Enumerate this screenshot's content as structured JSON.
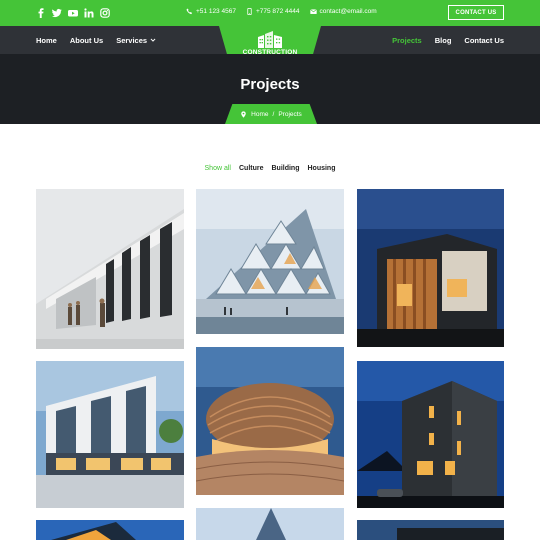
{
  "colors": {
    "accent": "#45c438",
    "nav_bg": "#2f3237",
    "hero_bg": "#1d2024"
  },
  "topbar": {
    "socials": [
      "facebook-icon",
      "twitter-icon",
      "youtube-icon",
      "linkedin-icon",
      "instagram-icon"
    ],
    "phone1": "+51 123 4567",
    "phone2": "+775 872 4444",
    "email": "contact@email.com",
    "contact_button": "CONTACT US"
  },
  "nav": {
    "left": [
      "Home",
      "About Us",
      "Services"
    ],
    "right": [
      "Projects",
      "Blog",
      "Contact Us"
    ],
    "active": "Projects"
  },
  "logo": {
    "text": "CONSTRUCTION"
  },
  "hero": {
    "title": "Projects"
  },
  "breadcrumb": {
    "home": "Home",
    "separator": "/",
    "current": "Projects"
  },
  "filters": [
    "Show all",
    "Culture",
    "Building",
    "Housing"
  ],
  "gallery": [
    "white-angular-building-with-people",
    "glass-triangle-facade-building-in-snow",
    "wooden-house-at-dusk",
    "modern-white-building-at-dusk",
    "copper-dome-building-at-dusk",
    "dark-tall-house-at-night",
    "building-partial-1",
    "building-partial-2",
    "building-partial-3"
  ]
}
